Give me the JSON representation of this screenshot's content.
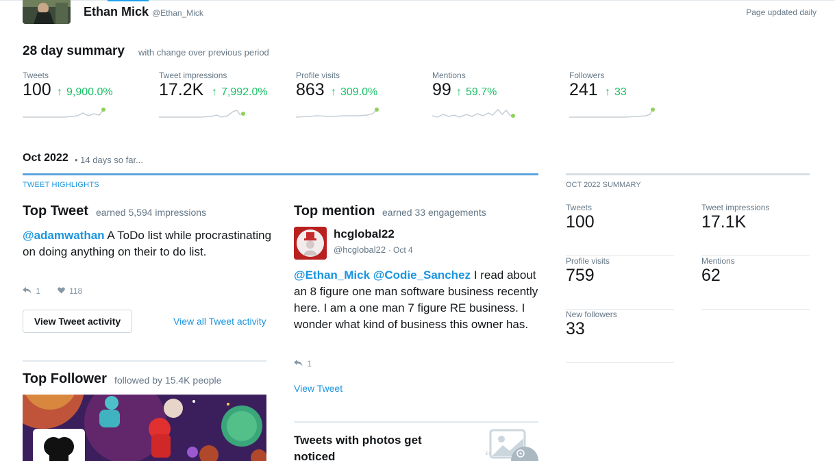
{
  "header": {
    "user_name": "Ethan Mick",
    "user_handle": "@Ethan_Mick",
    "page_updated": "Page updated daily"
  },
  "summary": {
    "title": "28 day summary",
    "subtitle": "with change over previous period",
    "metrics": [
      {
        "label": "Tweets",
        "value": "100",
        "change": "9,900.0%"
      },
      {
        "label": "Tweet impressions",
        "value": "17.2K",
        "change": "7,992.0%"
      },
      {
        "label": "Profile visits",
        "value": "863",
        "change": "309.0%"
      },
      {
        "label": "Mentions",
        "value": "99",
        "change": "59.7%"
      },
      {
        "label": "Followers",
        "value": "241",
        "change": "33"
      }
    ],
    "arrow_glyph": "↑",
    "up_color": "#17bf63"
  },
  "month": {
    "title": "Oct 2022",
    "subtitle": "• 14 days so far...",
    "highlights_label": "TWEET HIGHLIGHTS",
    "summary_label": "OCT 2022 SUMMARY"
  },
  "top_tweet": {
    "title": "Top Tweet",
    "subtitle": "earned 5,594 impressions",
    "mention": "@adamwathan",
    "text": " A ToDo list while procrastinating on doing anything on their to do list.",
    "reply_count": "1",
    "like_count": "118",
    "activity_button": "View Tweet activity",
    "all_activity_link": "View all Tweet activity"
  },
  "top_follower": {
    "title": "Top Follower",
    "subtitle": "followed by 15.4K people"
  },
  "top_mention": {
    "title": "Top mention",
    "subtitle": "earned 33 engagements",
    "name": "hcglobal22",
    "handle": "@hcglobal22",
    "date": "· Oct 4",
    "mention_1": "@Ethan_Mick",
    "mention_2": "@Codie_Sanchez",
    "text": " I read about an 8 figure one man software business recently here. I am a one man 7 figure RE business. I wonder what kind of business this owner has.",
    "reply_count": "1",
    "view_link": "View Tweet"
  },
  "photos_tip": {
    "title": "Tweets with photos get noticed"
  },
  "oct_summary": {
    "tweets_label": "Tweets",
    "tweets_value": "100",
    "impressions_label": "Tweet impressions",
    "impressions_value": "17.1K",
    "visits_label": "Profile visits",
    "visits_value": "759",
    "mentions_label": "Mentions",
    "mentions_value": "62",
    "followers_label": "New followers",
    "followers_value": "33"
  },
  "colors": {
    "link": "#1b95e0",
    "accent_rule": "#5ba4dd",
    "muted_text": "#657786"
  },
  "icons": {
    "reply": "reply-icon",
    "like": "heart-icon",
    "photo": "photo-icon"
  }
}
